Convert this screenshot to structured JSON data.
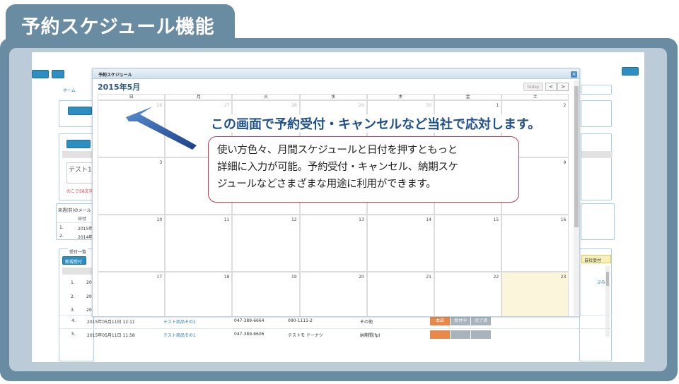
{
  "slide": {
    "title": "予約スケジュール機能",
    "headline": "この画面で予約受付・キャンセルなど当社で応対します。",
    "callout_lines": [
      "使い方色々、月間スケジュールと日付を押すともっと",
      "詳細に入力が可能。予約受付・キャンセル、納期スケ",
      "ジュールなどさまざまな用途に利用ができます。"
    ]
  },
  "colors": {
    "frame": "#6a8ca3",
    "frame_inner": "#bccbd8",
    "callout_border": "#c0385a",
    "headline": "#1e4f8f",
    "today_cell": "#fbf5dc"
  },
  "modal": {
    "title": "予約スケジュール",
    "close_icon": "close-icon",
    "calendar_title": "2015年5月",
    "today_label": "today",
    "prev_label": "<",
    "next_label": ">",
    "weekdays": [
      "日",
      "月",
      "火",
      "水",
      "木",
      "金",
      "土"
    ],
    "weeks": [
      [
        {
          "d": "26",
          "o": true
        },
        {
          "d": "27",
          "o": true
        },
        {
          "d": "28",
          "o": true
        },
        {
          "d": "29",
          "o": true
        },
        {
          "d": "30",
          "o": true
        },
        {
          "d": "1"
        },
        {
          "d": "2"
        }
      ],
      [
        {
          "d": "3"
        },
        {
          "d": ""
        },
        {
          "d": ""
        },
        {
          "d": ""
        },
        {
          "d": ""
        },
        {
          "d": ""
        },
        {
          "d": "9"
        }
      ],
      [
        {
          "d": "10"
        },
        {
          "d": "11"
        },
        {
          "d": "12"
        },
        {
          "d": "13"
        },
        {
          "d": "14"
        },
        {
          "d": "15"
        },
        {
          "d": "16"
        }
      ],
      [
        {
          "d": "17"
        },
        {
          "d": "18"
        },
        {
          "d": "19"
        },
        {
          "d": "20"
        },
        {
          "d": "21"
        },
        {
          "d": "22"
        },
        {
          "d": "23",
          "today": true
        }
      ]
    ]
  },
  "background_app": {
    "breadcrumb": "ホーム",
    "left_note": "のこり58文字",
    "memo_text": "テスト1",
    "history_title": "来週(前)のメール",
    "history_col": "日付",
    "history_rows": [
      [
        "1.",
        "2015年"
      ],
      [
        "2.",
        "2014年"
      ]
    ],
    "list_title": "受付一覧",
    "list_button": "新規受付",
    "right_button": "自社受付",
    "row_nums": [
      "1.",
      "2.",
      "3.",
      "4.",
      "5."
    ],
    "row_dates": [
      "20",
      "20",
      "20",
      "2015年05月11日 12:11",
      "2015年05月11日 11:58"
    ],
    "row4": {
      "name": "テスト商品その2",
      "tel1": "047-389-6664",
      "tel2": "090-1111-2",
      "kind": "その他",
      "status": "本店",
      "s2": "受付中",
      "s3": "完了済"
    },
    "row5": {
      "name": "テスト商品その1",
      "tel1": "047-389-6606",
      "tel2": "テストモ ドーナツ",
      "kind": "納期間(fp)"
    },
    "right_col_text": "ぷみ"
  }
}
